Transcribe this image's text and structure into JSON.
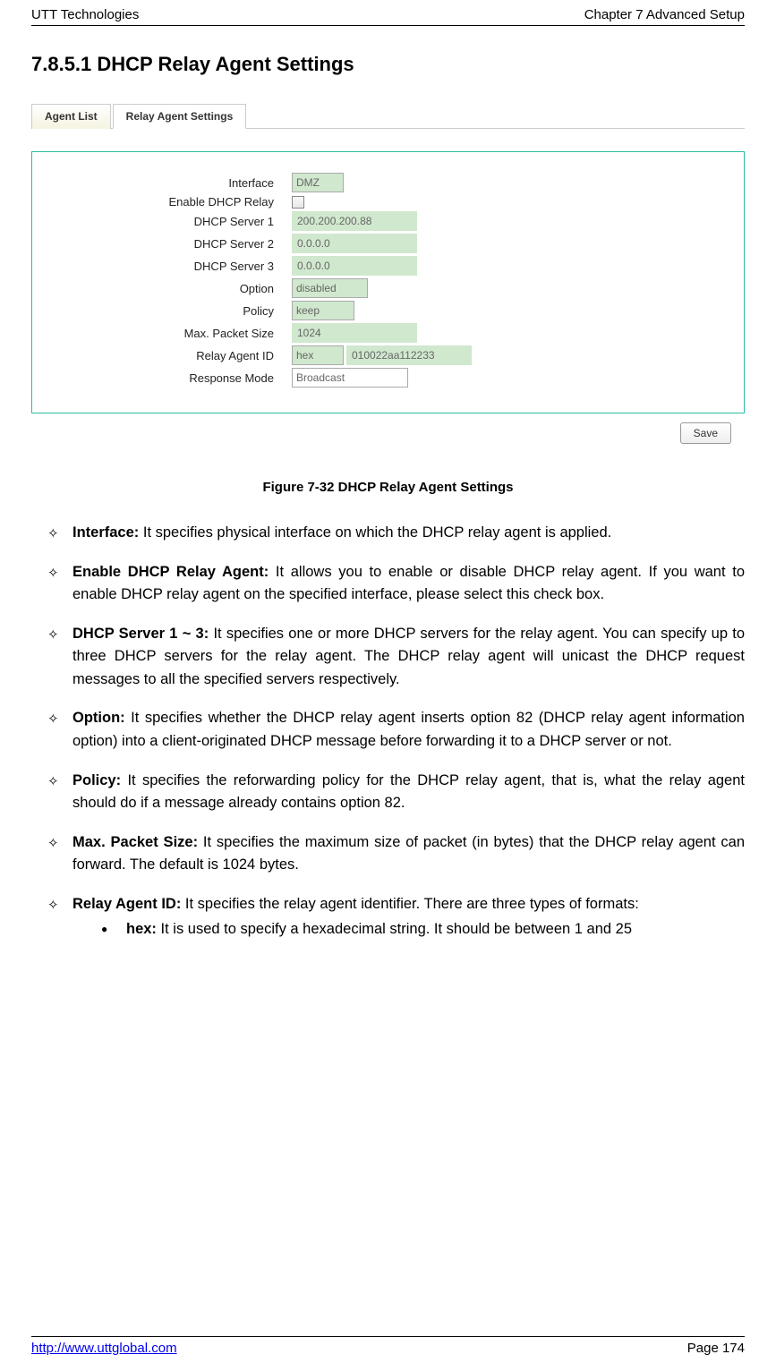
{
  "header": {
    "left": "UTT Technologies",
    "right_prefix": "Chapter 7 Advanced ",
    "right_suffix": "Setup"
  },
  "section_heading": "7.8.5.1   DHCP Relay Agent Settings",
  "tabs": {
    "inactive": "Agent List",
    "active": "Relay Agent Settings"
  },
  "form": {
    "interface_label": "Interface",
    "interface_value": "DMZ",
    "enable_label": "Enable DHCP Relay",
    "server1_label": "DHCP Server 1",
    "server1_value": "200.200.200.88",
    "server2_label": "DHCP Server 2",
    "server2_value": "0.0.0.0",
    "server3_label": "DHCP Server 3",
    "server3_value": "0.0.0.0",
    "option_label": "Option",
    "option_value": "disabled",
    "policy_label": "Policy",
    "policy_value": "keep",
    "maxpkt_label": "Max. Packet Size",
    "maxpkt_value": "1024",
    "agentid_label": "Relay Agent ID",
    "agentid_type": "hex",
    "agentid_value": "010022aa112233",
    "respmode_label": "Response Mode",
    "respmode_value": "Broadcast",
    "save_label": "Save"
  },
  "caption": "Figure 7-32 DHCP Relay Agent Settings",
  "defs": {
    "d1_term": "Interface:",
    "d1_text": " It specifies physical interface on which the DHCP relay agent is applied.",
    "d2_term": "Enable DHCP Relay Agent:",
    "d2_text": " It allows you to enable or disable DHCP relay agent. If you want to enable DHCP relay agent on the specified interface, please select this check box.",
    "d3_term": "DHCP Server 1 ~ 3:",
    "d3_text": " It specifies one or more DHCP servers for the relay agent. You can specify up to three DHCP servers for the relay agent. The DHCP relay agent will unicast the DHCP request messages to all the specified servers respectively.",
    "d4_term": "Option:",
    "d4_text": " It specifies whether the DHCP relay agent inserts option 82 (DHCP relay agent information option) into a client-originated DHCP message before forwarding it to a DHCP server or not.",
    "d5_term": "Policy:",
    "d5_text": " It specifies the reforwarding policy for the DHCP relay agent, that is, what the relay agent should do if a message already contains option 82.",
    "d6_term": "Max. Packet Size:",
    "d6_text": " It specifies the maximum size of packet (in bytes) that the DHCP relay agent can forward. The default is 1024 bytes.",
    "d7_term": "Relay Agent ID:",
    "d7_text": " It specifies the relay agent identifier. There are three types of formats:",
    "s1_term": "hex:",
    "s1_text": " It is used to specify a hexadecimal string. It should be between 1 and 25"
  },
  "footer": {
    "url": "http://www.uttglobal.com",
    "page": "Page 174"
  }
}
